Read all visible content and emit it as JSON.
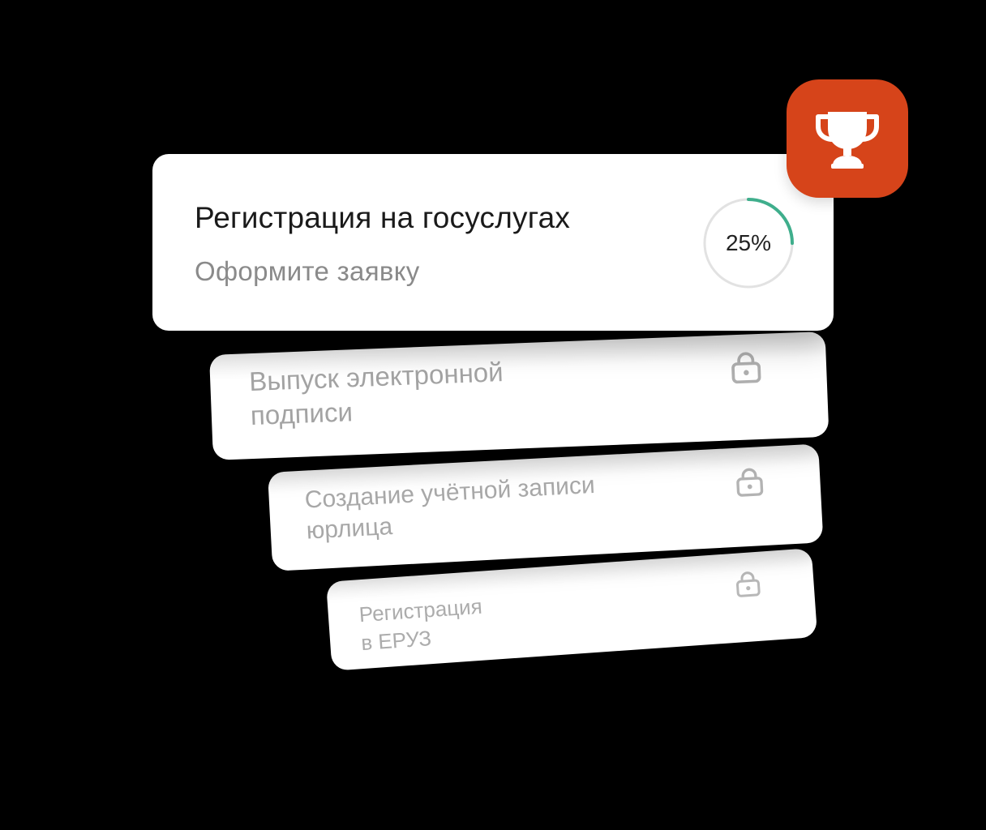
{
  "steps": [
    {
      "title": "Регистрация на госуслугах",
      "subtitle": "Оформите заявку",
      "progress_text": "25%",
      "progress_fraction": 0.25,
      "status": "active"
    },
    {
      "title": "Выпуск электронной\nподписи",
      "status": "locked",
      "icon": "lock-icon"
    },
    {
      "title": "Создание учётной записи\nюрлица",
      "status": "locked",
      "icon": "lock-icon"
    },
    {
      "title": "Регистрация\nв ЕРУЗ",
      "status": "locked",
      "icon": "lock-icon"
    }
  ],
  "badge": {
    "icon": "trophy-icon"
  },
  "colors": {
    "accent": "#d6441a",
    "progress": "#3fae8c",
    "progress_track": "#e2e2e2",
    "locked_text": "#a8a8a8"
  }
}
